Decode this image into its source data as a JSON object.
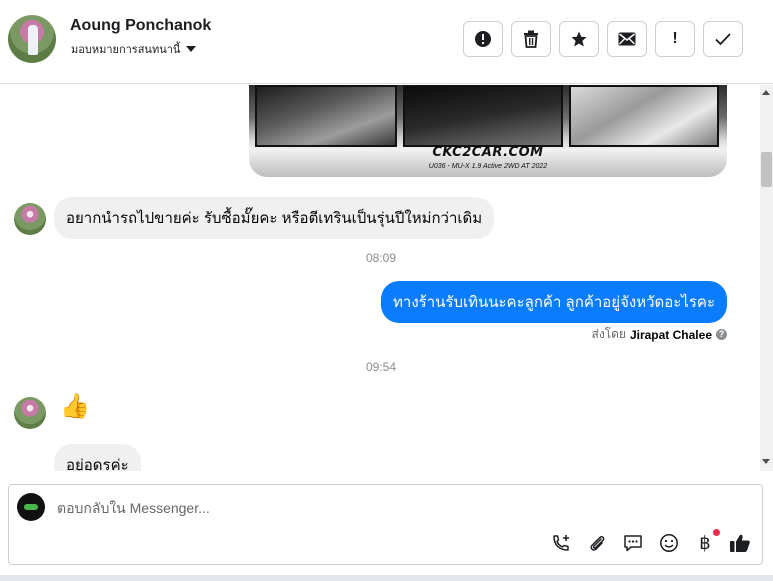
{
  "header": {
    "contact_name": "Aoung Ponchanok",
    "assign_label": "มอบหมายการสนทนานี้",
    "buttons": [
      {
        "icon": "alert-circle-icon",
        "glyph": "!"
      },
      {
        "icon": "trash-icon",
        "glyph": "🗑"
      },
      {
        "icon": "star-icon",
        "glyph": "★"
      },
      {
        "icon": "envelope-icon",
        "glyph": "✉"
      },
      {
        "icon": "exclamation-icon",
        "glyph": "!"
      },
      {
        "icon": "checkmark-icon",
        "glyph": "✓"
      }
    ]
  },
  "image": {
    "brand": "CKC2CAR.COM",
    "model": "U036 - MU-X 1.9 Active 2WD AT 2022"
  },
  "messages": {
    "incoming_1": "อยากนำรถไปขายค่ะ รับซื้อมั๊ยคะ หรือตีเทรินเป็นรุ่นปีใหม่กว่าเดิม",
    "timestamp_1": "08:09",
    "outgoing_1": "ทางร้านรับเทินนะคะลูกค้า ลูกค้าอยู่จังหวัดอะไรคะ",
    "sent_by_prefix": "ส่งโดย",
    "sent_by_name": "Jirapat Chalee",
    "timestamp_2": "09:54",
    "incoming_like": "👍",
    "incoming_2": "อยู่อุดรค่ะ"
  },
  "composer": {
    "placeholder": "ตอบกลับใน Messenger...",
    "tools": [
      "add-call-icon",
      "attachment-icon",
      "saved-reply-icon",
      "emoji-icon",
      "baht-payment-icon",
      "like-icon"
    ]
  },
  "colors": {
    "outgoing_bubble": "#0a7cff",
    "incoming_bubble": "#f0f0f0",
    "notification": "#f02849"
  }
}
